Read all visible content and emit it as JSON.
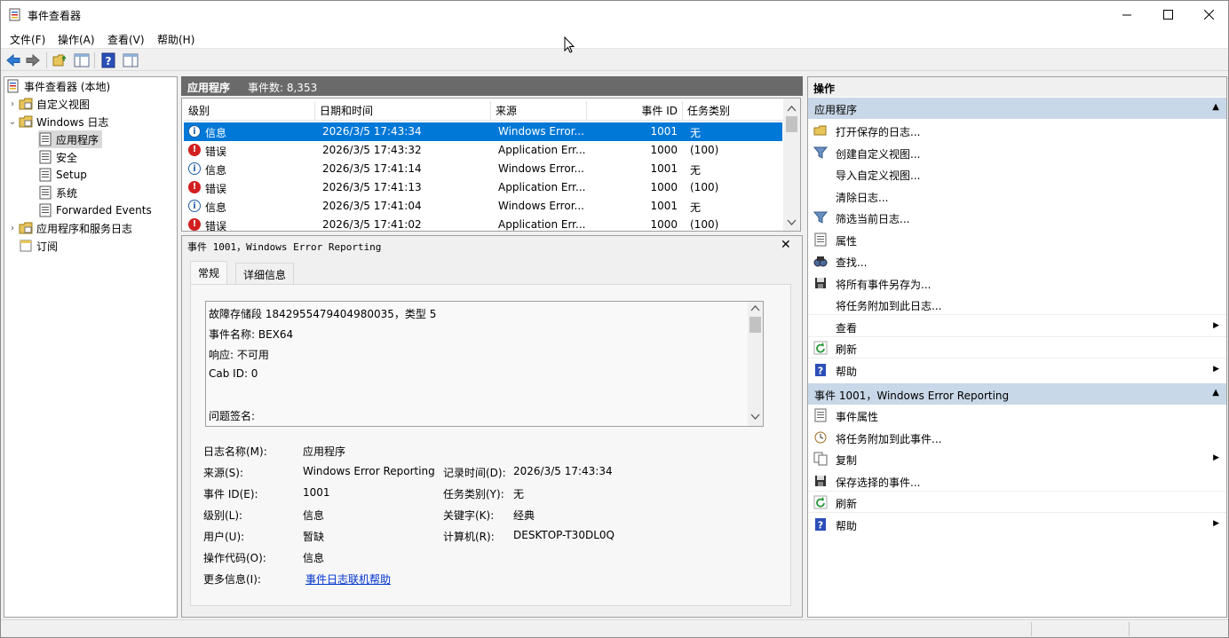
{
  "window": {
    "title": "事件查看器",
    "min_glyph": "─",
    "max_glyph": "☐",
    "close_glyph": "✕"
  },
  "menu": [
    "文件(F)",
    "操作(A)",
    "查看(V)",
    "帮助(H)"
  ],
  "tree": {
    "root": "事件查看器 (本地)",
    "custom_views": "自定义视图",
    "windows_logs": "Windows 日志",
    "application": "应用程序",
    "security": "安全",
    "setup": "Setup",
    "system": "系统",
    "forwarded": "Forwarded Events",
    "app_service_logs": "应用程序和服务日志",
    "subscriptions": "订阅",
    "expand_glyph": "›",
    "expanded_glyph": "⌄"
  },
  "center": {
    "log_name": "应用程序",
    "event_count": "事件数: 8,353",
    "columns": [
      "级别",
      "日期和时间",
      "来源",
      "事件 ID",
      "任务类别"
    ],
    "rows": [
      {
        "level": "信息",
        "kind": "info",
        "datetime": "2026/3/5 17:43:34",
        "source": "Windows Error...",
        "id": "1001",
        "category": "无",
        "selected": true
      },
      {
        "level": "错误",
        "kind": "error",
        "datetime": "2026/3/5 17:43:32",
        "source": "Application Err...",
        "id": "1000",
        "category": "(100)",
        "selected": false
      },
      {
        "level": "信息",
        "kind": "info",
        "datetime": "2026/3/5 17:41:14",
        "source": "Windows Error...",
        "id": "1001",
        "category": "无",
        "selected": false
      },
      {
        "level": "错误",
        "kind": "error",
        "datetime": "2026/3/5 17:41:13",
        "source": "Application Err...",
        "id": "1000",
        "category": "(100)",
        "selected": false
      },
      {
        "level": "信息",
        "kind": "info",
        "datetime": "2026/3/5 17:41:04",
        "source": "Windows Error...",
        "id": "1001",
        "category": "无",
        "selected": false
      },
      {
        "level": "错误",
        "kind": "error",
        "datetime": "2026/3/5 17:41:02",
        "source": "Application Err...",
        "id": "1000",
        "category": "(100)",
        "selected": false
      }
    ]
  },
  "detail": {
    "title": "事件 1001，Windows Error Reporting",
    "close_glyph": "✕",
    "tabs": [
      "常规",
      "详细信息"
    ],
    "description": [
      "故障存储段 1842955479404980035，类型 5",
      "事件名称: BEX64",
      "响应: 不可用",
      "Cab ID: 0",
      "",
      "问题签名:"
    ],
    "props": {
      "log_name_label": "日志名称(M):",
      "log_name": "应用程序",
      "source_label": "来源(S):",
      "source": "Windows Error Reporting",
      "logged_label": "记录时间(D):",
      "logged": "2026/3/5 17:43:34",
      "event_id_label": "事件 ID(E):",
      "event_id": "1001",
      "task_label": "任务类别(Y):",
      "task": "无",
      "level_label": "级别(L):",
      "level": "信息",
      "keywords_label": "关键字(K):",
      "keywords": "经典",
      "user_label": "用户(U):",
      "user": "暂缺",
      "computer_label": "计算机(R):",
      "computer": "DESKTOP-T30DL0Q",
      "opcode_label": "操作代码(O):",
      "opcode": "信息",
      "more_info_label": "更多信息(I):",
      "more_info_link": "事件日志联机帮助"
    }
  },
  "actions": {
    "header": "操作",
    "section1": "应用程序",
    "section1_items": [
      "打开保存的日志...",
      "创建自定义视图...",
      "导入自定义视图...",
      "清除日志...",
      "筛选当前日志...",
      "属性",
      "查找...",
      "将所有事件另存为...",
      "将任务附加到此日志...",
      "查看",
      "刷新",
      "帮助"
    ],
    "section2": "事件 1001，Windows Error Reporting",
    "section2_items": [
      "事件属性",
      "将任务附加到此事件...",
      "复制",
      "保存选择的事件...",
      "刷新",
      "帮助"
    ],
    "collapse_glyph": "▲",
    "submenu_glyph": "▶"
  }
}
